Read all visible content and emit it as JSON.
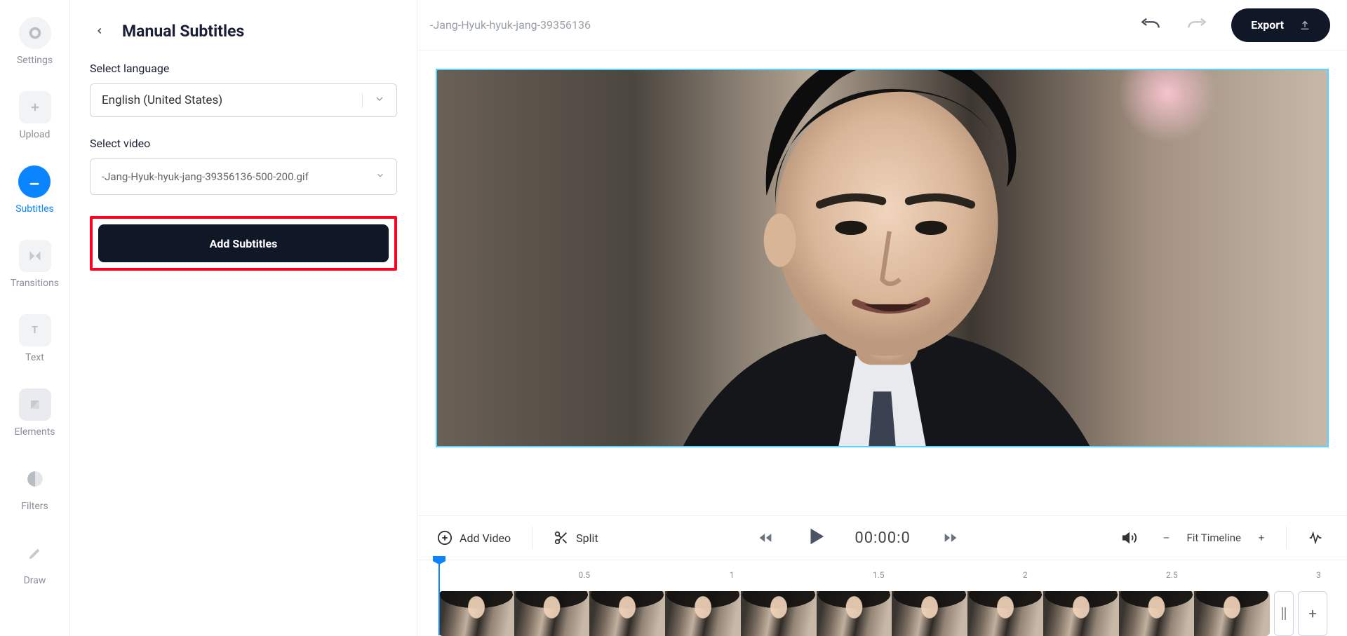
{
  "nav": {
    "items": [
      {
        "id": "settings",
        "label": "Settings"
      },
      {
        "id": "upload",
        "label": "Upload"
      },
      {
        "id": "subtitles",
        "label": "Subtitles"
      },
      {
        "id": "transitions",
        "label": "Transitions"
      },
      {
        "id": "text",
        "label": "Text"
      },
      {
        "id": "elements",
        "label": "Elements"
      },
      {
        "id": "filters",
        "label": "Filters"
      },
      {
        "id": "draw",
        "label": "Draw"
      }
    ],
    "active": "subtitles"
  },
  "panel": {
    "title": "Manual Subtitles",
    "language_label": "Select language",
    "language_value": "English (United States)",
    "video_label": "Select video",
    "video_value": "-Jang-Hyuk-hyuk-jang-39356136-500-200.gif",
    "add_button": "Add Subtitles"
  },
  "topbar": {
    "video_name": "-Jang-Hyuk-hyuk-jang-39356136",
    "export_label": "Export"
  },
  "timeline": {
    "add_video": "Add Video",
    "split": "Split",
    "time": "00:00:0",
    "fit_label": "Fit Timeline",
    "ruler": [
      "0.5",
      "1",
      "1.5",
      "2",
      "2.5",
      "3"
    ]
  }
}
